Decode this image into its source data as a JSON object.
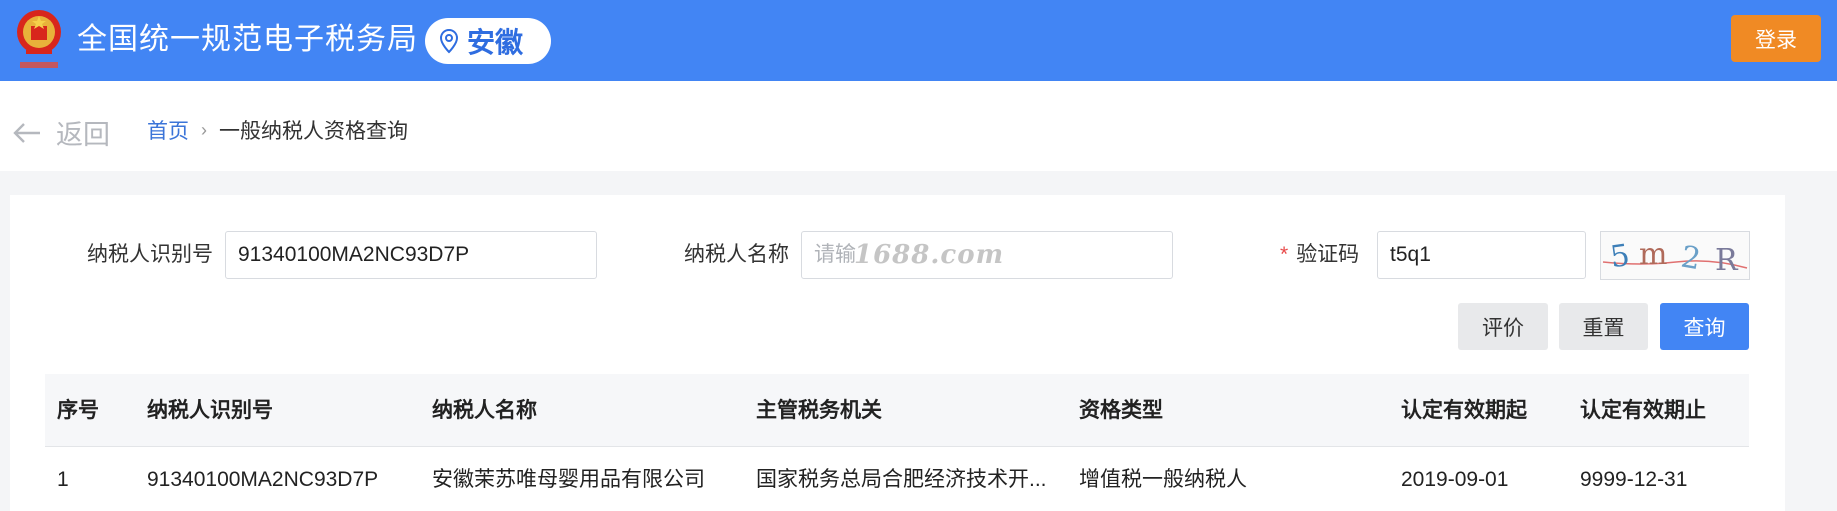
{
  "header": {
    "title": "全国统一规范电子税务局",
    "region": "安徽",
    "login_label": "登录",
    "emblem_icon": "national-emblem-icon",
    "region_icon": "location-pin-icon",
    "brand_color": "#4285f4",
    "login_color": "#f08a24"
  },
  "nav": {
    "back_label": "返回",
    "breadcrumb_home": "首页",
    "breadcrumb_separator": "›",
    "breadcrumb_current": "一般纳税人资格查询"
  },
  "form": {
    "taxpayer_id_label": "纳税人识别号",
    "taxpayer_id_value": "91340100MA2NC93D7P",
    "taxpayer_name_label": "纳税人名称",
    "taxpayer_name_placeholder": "请输",
    "captcha_label": "验证码",
    "captcha_required_mark": "*",
    "captcha_value": "t5q1",
    "captcha_image_text": "5 m 2 R",
    "watermark": "1688.com"
  },
  "actions": {
    "evaluate_label": "评价",
    "reset_label": "重置",
    "query_label": "查询"
  },
  "table": {
    "headers": [
      "序号",
      "纳税人识别号",
      "纳税人名称",
      "主管税务机关",
      "资格类型",
      "认定有效期起",
      "认定有效期止"
    ],
    "rows": [
      [
        "1",
        "91340100MA2NC93D7P",
        "安徽茉苏唯母婴用品有限公司",
        "国家税务总局合肥经济技术开...",
        "增值税一般纳税人",
        "2019-09-01",
        "9999-12-31"
      ]
    ]
  }
}
